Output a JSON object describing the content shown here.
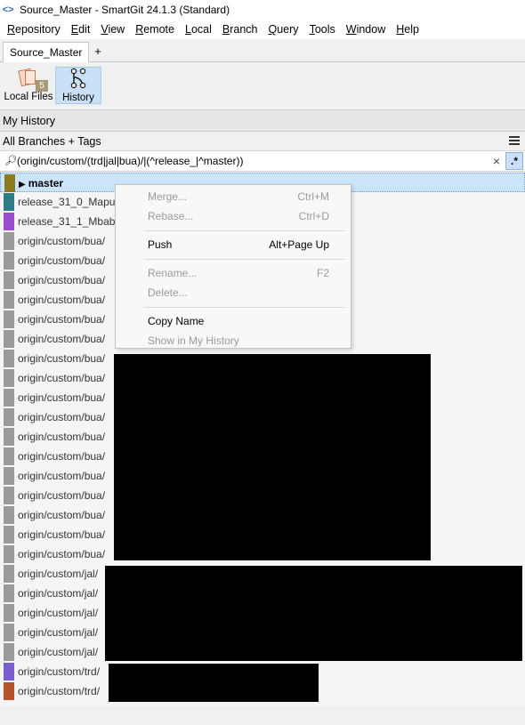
{
  "window": {
    "title": "Source_Master - SmartGit 24.1.3 (Standard)"
  },
  "menu": [
    "Repository",
    "Edit",
    "View",
    "Remote",
    "Local",
    "Branch",
    "Query",
    "Tools",
    "Window",
    "Help"
  ],
  "tabs": {
    "active": "Source_Master",
    "add": "+"
  },
  "toolbar": {
    "local_files_label": "Local Files",
    "local_files_count": "5",
    "history_label": "History"
  },
  "panel": {
    "title": "My History",
    "scope": "All Branches + Tags"
  },
  "filter": {
    "value": "(origin/custom/(trd|jal|bua)/|(^release_|^master))",
    "clear": "×",
    "regex": ".*"
  },
  "branches": [
    {
      "label": "master",
      "color": "#8e7a1e",
      "selected": true
    },
    {
      "label": "release_31_0_Maputo",
      "color": "#2e7d86"
    },
    {
      "label": "release_31_1_Mbabane",
      "color": "#9b4fd0"
    },
    {
      "label": "origin/custom/bua/",
      "color": "#9a9a9a"
    },
    {
      "label": "origin/custom/bua/",
      "color": "#9a9a9a"
    },
    {
      "label": "origin/custom/bua/",
      "color": "#9a9a9a"
    },
    {
      "label": "origin/custom/bua/",
      "color": "#9a9a9a"
    },
    {
      "label": "origin/custom/bua/",
      "color": "#9a9a9a"
    },
    {
      "label": "origin/custom/bua/",
      "color": "#9a9a9a"
    },
    {
      "label": "origin/custom/bua/",
      "color": "#9a9a9a"
    },
    {
      "label": "origin/custom/bua/",
      "color": "#9a9a9a"
    },
    {
      "label": "origin/custom/bua/",
      "color": "#9a9a9a"
    },
    {
      "label": "origin/custom/bua/",
      "color": "#9a9a9a"
    },
    {
      "label": "origin/custom/bua/",
      "color": "#9a9a9a"
    },
    {
      "label": "origin/custom/bua/",
      "color": "#9a9a9a"
    },
    {
      "label": "origin/custom/bua/",
      "color": "#9a9a9a"
    },
    {
      "label": "origin/custom/bua/",
      "color": "#9a9a9a"
    },
    {
      "label": "origin/custom/bua/",
      "color": "#9a9a9a"
    },
    {
      "label": "origin/custom/bua/",
      "color": "#9a9a9a"
    },
    {
      "label": "origin/custom/bua/",
      "color": "#9a9a9a"
    },
    {
      "label": "origin/custom/jal/",
      "color": "#9a9a9a"
    },
    {
      "label": "origin/custom/jal/",
      "color": "#9a9a9a"
    },
    {
      "label": "origin/custom/jal/",
      "color": "#9a9a9a"
    },
    {
      "label": "origin/custom/jal/",
      "color": "#9a9a9a"
    },
    {
      "label": "origin/custom/jal/",
      "color": "#9a9a9a"
    },
    {
      "label": "origin/custom/trd/",
      "color": "#7b5fcf"
    },
    {
      "label": "origin/custom/trd/",
      "color": "#b5522e"
    }
  ],
  "context_menu": [
    {
      "label": "Merge...",
      "shortcut": "Ctrl+M",
      "enabled": false
    },
    {
      "label": "Rebase...",
      "shortcut": "Ctrl+D",
      "enabled": false
    },
    {
      "separator": true
    },
    {
      "label": "Push",
      "shortcut": "Alt+Page Up",
      "enabled": true
    },
    {
      "separator": true
    },
    {
      "label": "Rename...",
      "shortcut": "F2",
      "enabled": false
    },
    {
      "label": "Delete...",
      "shortcut": "",
      "enabled": false
    },
    {
      "separator": true
    },
    {
      "label": "Copy Name",
      "shortcut": "",
      "enabled": true
    },
    {
      "label": "Show in My History",
      "shortcut": "",
      "enabled": false
    }
  ]
}
